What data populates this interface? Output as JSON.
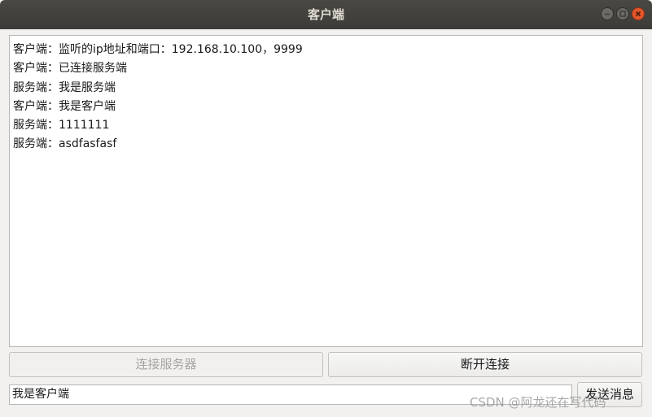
{
  "window": {
    "title": "客户端",
    "controls": [
      "minimize-icon",
      "maximize-icon",
      "close-icon"
    ]
  },
  "log": {
    "lines": [
      "客户端：监听的ip地址和端口：192.168.10.100，9999",
      "客户端：已连接服务端",
      "服务端：我是服务端",
      "客户端：我是客户端",
      "服务端：1111111",
      "服务端：asdfasfasf"
    ]
  },
  "buttons": {
    "connect_label": "连接服务器",
    "disconnect_label": "断开连接",
    "send_label": "发送消息"
  },
  "message_input": {
    "value": "我是客户端"
  },
  "watermark": "CSDN @阿龙还在写代码",
  "colors": {
    "titlebar": "#3c3b37",
    "close_button": "#e2572a",
    "window_bg": "#f2f1f0"
  }
}
